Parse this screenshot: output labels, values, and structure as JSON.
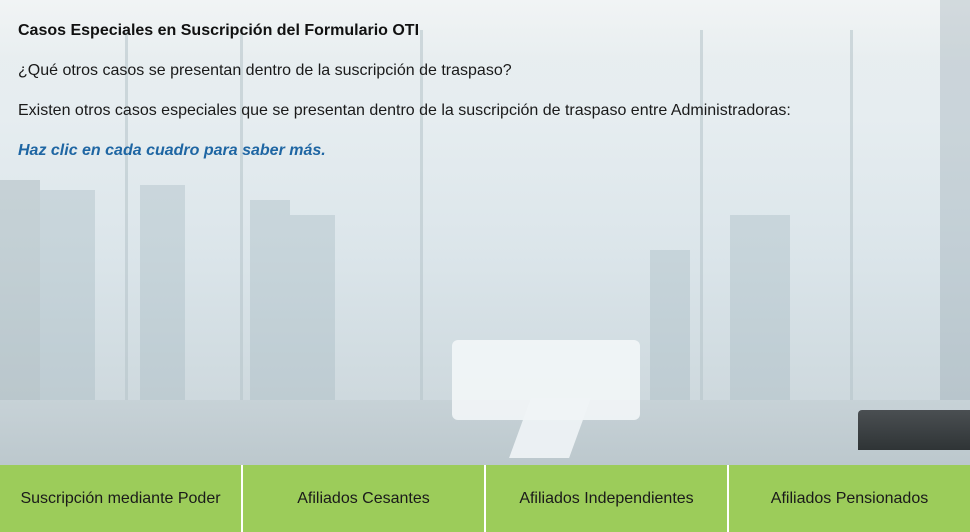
{
  "content": {
    "title": "Casos Especiales en Suscripción del Formulario OTI",
    "question": "¿Qué otros casos se presentan dentro de la suscripción de traspaso?",
    "description": "Existen otros casos especiales que se presentan dentro de la suscripción de traspaso entre Administradoras:",
    "hint": "Haz clic en cada cuadro para saber más."
  },
  "buttons": [
    {
      "label": "Suscripción mediante Poder"
    },
    {
      "label": "Afiliados Cesantes"
    },
    {
      "label": "Afiliados Independientes"
    },
    {
      "label": "Afiliados Pensionados"
    }
  ],
  "colors": {
    "button_bg": "#9ccc5a",
    "hint_text": "#1f66a3"
  }
}
